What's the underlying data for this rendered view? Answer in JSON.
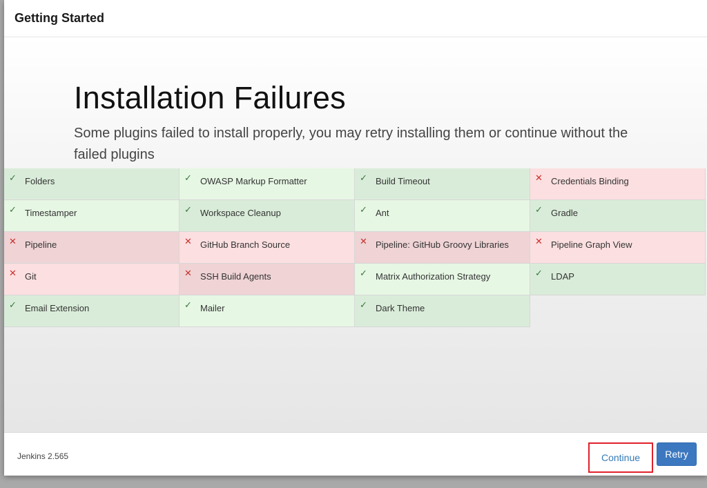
{
  "dialog": {
    "title": "Getting Started"
  },
  "main": {
    "heading": "Installation Failures",
    "subtitle": "Some plugins failed to install properly, you may retry installing them or continue without the failed plugins"
  },
  "plugins": [
    {
      "name": "Folders",
      "status": "success"
    },
    {
      "name": "OWASP Markup Formatter",
      "status": "success"
    },
    {
      "name": "Build Timeout",
      "status": "success"
    },
    {
      "name": "Credentials Binding",
      "status": "failed"
    },
    {
      "name": "Timestamper",
      "status": "success"
    },
    {
      "name": "Workspace Cleanup",
      "status": "success"
    },
    {
      "name": "Ant",
      "status": "success"
    },
    {
      "name": "Gradle",
      "status": "success"
    },
    {
      "name": "Pipeline",
      "status": "failed"
    },
    {
      "name": "GitHub Branch Source",
      "status": "failed"
    },
    {
      "name": "Pipeline: GitHub Groovy Libraries",
      "status": "failed"
    },
    {
      "name": "Pipeline Graph View",
      "status": "failed"
    },
    {
      "name": "Git",
      "status": "failed"
    },
    {
      "name": "SSH Build Agents",
      "status": "failed"
    },
    {
      "name": "Matrix Authorization Strategy",
      "status": "success"
    },
    {
      "name": "LDAP",
      "status": "success"
    },
    {
      "name": "Email Extension",
      "status": "success"
    },
    {
      "name": "Mailer",
      "status": "success"
    },
    {
      "name": "Dark Theme",
      "status": "success"
    }
  ],
  "icons": {
    "success": "✓",
    "failed": "✕"
  },
  "colors": {
    "success_bg": "#e6f7e4",
    "failed_bg": "#fcdfe0",
    "primary": "#3c78c0",
    "highlight": "#e0202a"
  },
  "footer": {
    "version": "Jenkins 2.565",
    "continue_label": "Continue",
    "retry_label": "Retry"
  }
}
